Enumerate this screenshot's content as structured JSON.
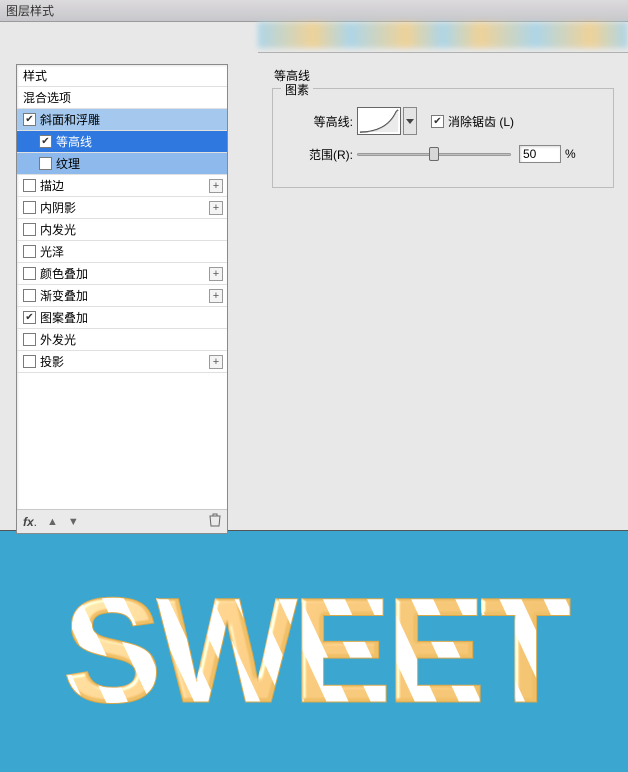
{
  "window": {
    "title": "图层样式"
  },
  "left": {
    "header_styles": "样式",
    "header_blend": "混合选项",
    "items": [
      {
        "id": "bevel",
        "label": "斜面和浮雕",
        "checked": true,
        "hasPlus": false,
        "indent": false,
        "state": "sel-parent"
      },
      {
        "id": "contour",
        "label": "等高线",
        "checked": true,
        "hasPlus": false,
        "indent": true,
        "state": "selected"
      },
      {
        "id": "texture",
        "label": "纹理",
        "checked": false,
        "hasPlus": false,
        "indent": true,
        "state": "sub-hilite"
      },
      {
        "id": "stroke",
        "label": "描边",
        "checked": false,
        "hasPlus": true,
        "indent": false,
        "state": ""
      },
      {
        "id": "innershadow",
        "label": "内阴影",
        "checked": false,
        "hasPlus": true,
        "indent": false,
        "state": ""
      },
      {
        "id": "innerglow",
        "label": "内发光",
        "checked": false,
        "hasPlus": false,
        "indent": false,
        "state": ""
      },
      {
        "id": "satin",
        "label": "光泽",
        "checked": false,
        "hasPlus": false,
        "indent": false,
        "state": ""
      },
      {
        "id": "coloroverlay",
        "label": "颜色叠加",
        "checked": false,
        "hasPlus": true,
        "indent": false,
        "state": ""
      },
      {
        "id": "gradoverlay",
        "label": "渐变叠加",
        "checked": false,
        "hasPlus": true,
        "indent": false,
        "state": ""
      },
      {
        "id": "patoverlay",
        "label": "图案叠加",
        "checked": true,
        "hasPlus": false,
        "indent": false,
        "state": ""
      },
      {
        "id": "outerglow",
        "label": "外发光",
        "checked": false,
        "hasPlus": false,
        "indent": false,
        "state": ""
      },
      {
        "id": "dropshadow",
        "label": "投影",
        "checked": false,
        "hasPlus": true,
        "indent": false,
        "state": ""
      }
    ],
    "footer_fx": "fx"
  },
  "right": {
    "section_title": "等高线",
    "group_legend": "图素",
    "contour_label": "等高线:",
    "antialias_label": "消除锯齿 (L)",
    "antialias_checked": true,
    "range_label": "范围(R):",
    "range_value": "50",
    "range_unit": "%"
  },
  "preview": {
    "text": "SWEET",
    "bg_color": "#3ba7d1",
    "stripe_color1": "#f0c068",
    "stripe_color2": "#ffffff"
  }
}
